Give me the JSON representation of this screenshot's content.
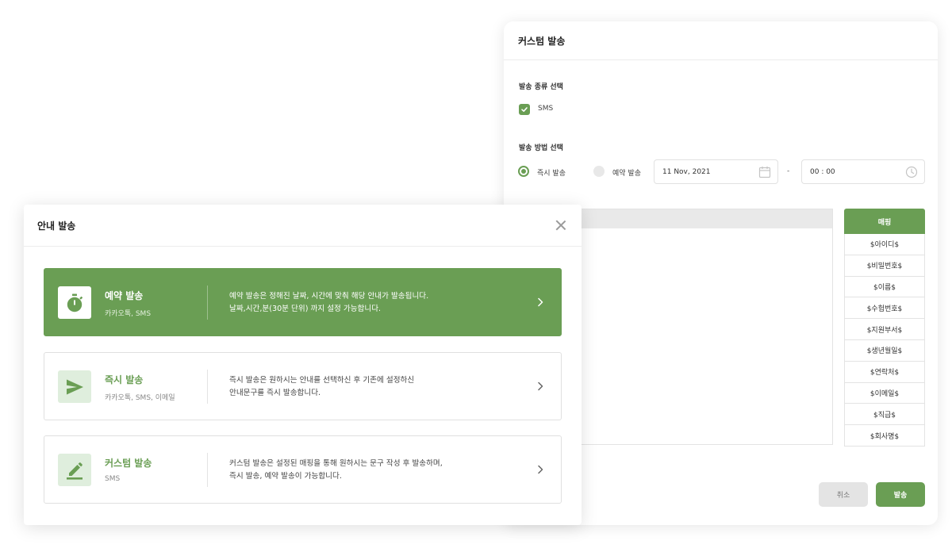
{
  "custom_modal": {
    "title": "커스텀 발송",
    "type_label": "발송 종류 선택",
    "sms_label": "SMS",
    "method_label": "발송 방법 선택",
    "radio_now": "즉시 발송",
    "radio_reserve": "예약 발송",
    "date_value": "11 Nov, 2021",
    "dash": "-",
    "time_value": "00 : 00",
    "mapping_header": "매핑",
    "mapping_items": [
      "$아이디$",
      "$비밀번호$",
      "$이름$",
      "$수험번호$",
      "$지원부서$",
      "$생년월일$",
      "$연락처$",
      "$이메일$",
      "$직급$",
      "$회사명$"
    ],
    "cancel_label": "취소",
    "send_label": "발송"
  },
  "guide_modal": {
    "title": "안내 발송",
    "options": [
      {
        "title": "예약 발송",
        "subtitle": "카카오톡, SMS",
        "desc_line1": "예약 발송은 정해진 날짜, 시간에 맞춰 해당 안내가 발송됩니다.",
        "desc_line2": "날짜,시간,분(30분 단위) 까지 설정 가능합니다.",
        "icon": "stopwatch-icon"
      },
      {
        "title": "즉시 발송",
        "subtitle": "카카오톡, SMS, 이메일",
        "desc_line1": "즉시 발송은 원하시는 안내를 선택하신 후 기존에 설정하신",
        "desc_line2": "안내문구를 즉시 발송합니다.",
        "icon": "send-icon"
      },
      {
        "title": "커스텀 발송",
        "subtitle": "SMS",
        "desc_line1": "커스텀 발송은 설정된 매핑을 통해 원하시는 문구 작성 후 발송하며,",
        "desc_line2": "즉시 발송, 예약 발송이 가능합니다.",
        "icon": "edit-icon"
      }
    ]
  },
  "colors": {
    "accent": "#6a9e54",
    "accent_light": "#dfeedd"
  }
}
